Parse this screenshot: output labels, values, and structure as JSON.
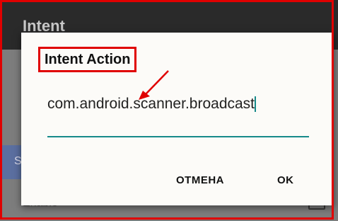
{
  "background": {
    "app_title": "Intent",
    "row_label": "Enable",
    "blue_item_letter": "S"
  },
  "dialog": {
    "title": "Intent Action",
    "input_value": "com.android.scanner.broadcast",
    "cancel_label": "ОТМЕНА",
    "ok_label": "OK"
  },
  "colors": {
    "accent": "#168a8a",
    "annotation": "#e00000"
  }
}
